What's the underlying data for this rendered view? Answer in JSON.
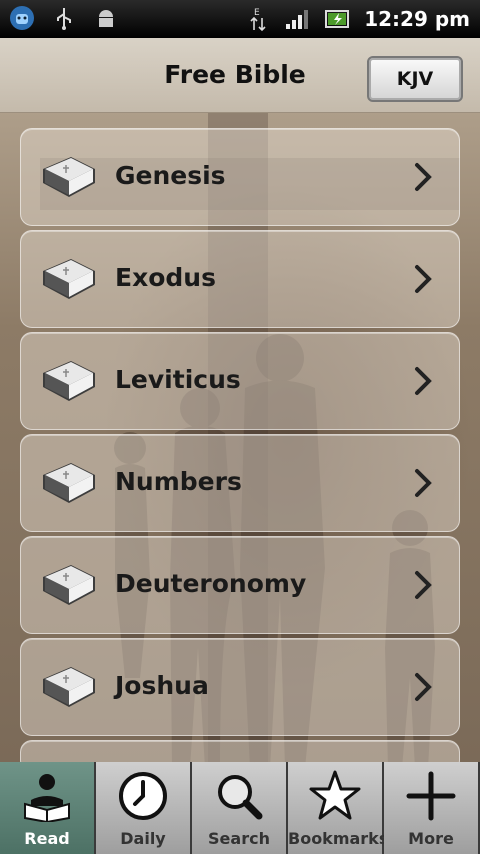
{
  "status": {
    "time": "12:29 pm",
    "icons": [
      "android-robot-icon",
      "usb-icon",
      "android-debug-icon",
      "data-arrows-icon",
      "signal-icon",
      "battery-icon"
    ],
    "network_label": "E"
  },
  "header": {
    "title": "Free Bible",
    "version_button": "KJV"
  },
  "books": [
    {
      "label": "Genesis"
    },
    {
      "label": "Exodus"
    },
    {
      "label": "Leviticus"
    },
    {
      "label": "Numbers"
    },
    {
      "label": "Deuteronomy"
    },
    {
      "label": "Joshua"
    }
  ],
  "tabs": [
    {
      "label": "Read",
      "icon": "reader-icon",
      "active": true
    },
    {
      "label": "Daily",
      "icon": "clock-icon",
      "active": false
    },
    {
      "label": "Search",
      "icon": "magnifier-icon",
      "active": false
    },
    {
      "label": "Bookmarks",
      "icon": "star-icon",
      "active": false
    },
    {
      "label": "More",
      "icon": "plus-icon",
      "active": false
    }
  ],
  "colors": {
    "active_tab": "#5e8377",
    "tab_bg": "#b8b8b8",
    "accent_green": "#4c9a2a"
  }
}
